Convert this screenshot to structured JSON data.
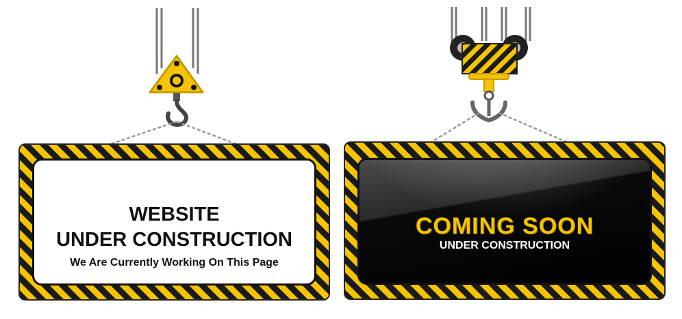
{
  "left_sign": {
    "line1": "WEBSITE",
    "line2": "UNDER CONSTRUCTION",
    "line3": "We Are Currently Working On This Page"
  },
  "right_sign": {
    "line1": "COMING SOON",
    "line2": "UNDER CONSTRUCTION"
  },
  "colors": {
    "hazard_yellow": "#f5c400",
    "hazard_black": "#1a1a1a",
    "left_panel": "#ffffff",
    "right_panel": "#000000"
  },
  "icons": {
    "left_hook": "crane-hook-icon",
    "right_hook": "anchor-hook-icon"
  }
}
